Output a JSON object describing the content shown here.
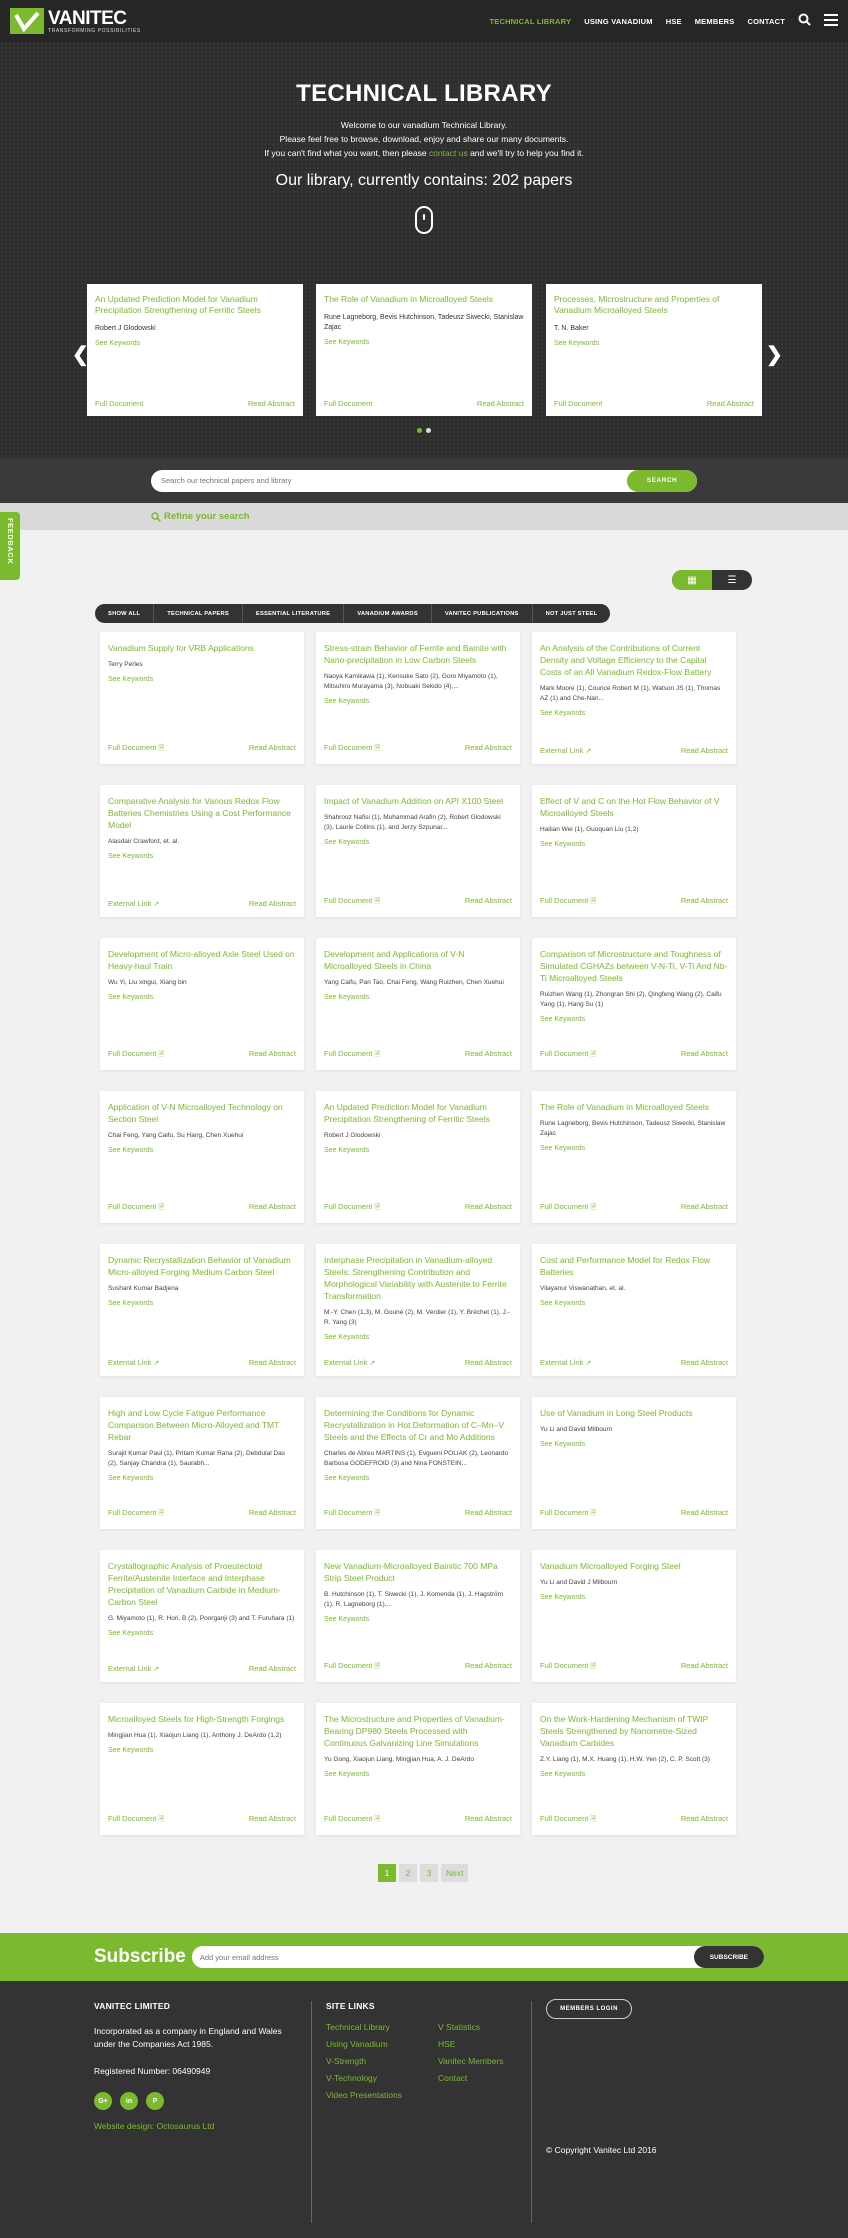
{
  "header": {
    "logo_name": "VANITEC",
    "logo_tagline": "TRANSFORMING POSSIBILITIES",
    "nav": [
      "TECHNICAL LIBRARY",
      "USING VANADIUM",
      "HSE",
      "MEMBERS",
      "CONTACT"
    ],
    "icons": [
      "search-icon",
      "menu-icon"
    ]
  },
  "hero": {
    "title": "TECHNICAL LIBRARY",
    "intro_line1": "Welcome to our vanadium Technical Library.",
    "intro_line2": "Please feel free to browse, download, enjoy and share our many documents.",
    "intro_line3_pre": "If you can't find what you want, then please ",
    "intro_line3_link": "contact us",
    "intro_line3_post": " and we'll try to help you find it.",
    "count": "Our library, currently contains: 202 papers"
  },
  "carousel": {
    "cards": [
      {
        "title": "An Updated Prediction Model for Vanadium Precipitation Strengthening of Ferritic Steels",
        "authors": "Robert J Glodowski",
        "keywords": "See Keywords",
        "doc": "Full Document",
        "abstract": "Read Abstract"
      },
      {
        "title": "The Role of Vanadium in Microalloyed Steels",
        "authors": "Rune Lagneborg, Bevis Hutchinson, Tadeusz Siwecki, Stanislaw Zajac",
        "keywords": "See Keywords",
        "doc": "Full Document",
        "abstract": "Read Abstract"
      },
      {
        "title": "Processes, Microstructure and Properties of Vanadium Microalloyed Steels",
        "authors": "T. N. Baker",
        "keywords": "See Keywords",
        "doc": "Full Document",
        "abstract": "Read Abstract"
      }
    ],
    "active_slide": 1,
    "slide_count": 2
  },
  "search": {
    "placeholder": "Search our technical papers and library",
    "button": "SEARCH",
    "refine": "Refine your search"
  },
  "feedback": "FEEDBACK",
  "filters": [
    "SHOW ALL",
    "TECHNICAL PAPERS",
    "ESSENTIAL LITERATURE",
    "VANADIUM AWARDS",
    "VANITEC PUBLICATIONS",
    "NOT JUST STEEL"
  ],
  "papers": [
    {
      "title": "Vanadium Supply for VRB Applications",
      "authors": "Terry Perles",
      "keywords": "See Keywords",
      "doc": "Full Document",
      "abstract": "Read Abstract"
    },
    {
      "title": "Stress-strain Behavior of Ferrite and Bainite with Nano-precipitation in Low Carbon Steels",
      "authors": "Naoya Kamikawa (1), Kensuke Sato (2), Goro Miyamoto (1), Mitsuhiro Murayama (3), Nobuaki Sekido (4),...",
      "keywords": "See Keywords",
      "doc": "Full Document",
      "abstract": "Read Abstract"
    },
    {
      "title": "An Analysis of the Contributions of Current Density and Voltage Efficiency to the Capital Costs of an All Vanadium Redox-Flow Battery",
      "authors": "Mark Moore (1), Counce Robert M (1), Watson JS (1), Thomas AZ (1) and Che-Nan...",
      "keywords": "See Keywords",
      "doc": "External Link",
      "abstract": "Read Abstract"
    },
    {
      "title": "Comparative Analysis for Various Redox Flow Batteries Chemistries Using a Cost Performance Model",
      "authors": "Alasdair Crawford, et. al.",
      "keywords": "See Keywords",
      "doc": "External Link",
      "abstract": "Read Abstract"
    },
    {
      "title": "Impact of Vanadium Addition on API X100 Steel",
      "authors": "Shahrooz Nafisi (1), Muhammad Arafin (2), Robert Glodowski (3), Laurie Collins (1), and Jerzy Szpunar...",
      "keywords": "See Keywords",
      "doc": "Full Document",
      "abstract": "Read Abstract"
    },
    {
      "title": "Effect of V and C on the Hot Flow Behavior of V Microalloyed Steels",
      "authors": "Hailian Wei (1), Guoquan Liu (1,2)",
      "keywords": "See Keywords",
      "doc": "Full Document",
      "abstract": "Read Abstract"
    },
    {
      "title": "Development of Micro-alloyed Axle Steel Used on Heavy-haul Train",
      "authors": "Wu Yi, Liu xingui, Xiang bin",
      "keywords": "See Keywords",
      "doc": "Full Document",
      "abstract": "Read Abstract"
    },
    {
      "title": "Development and Applications of V-N Microalloyed Steels in China",
      "authors": "Yang Caifu, Pan Tao, Chai Feng, Wang Ruizhen, Chen Xuehui",
      "keywords": "See Keywords",
      "doc": "Full Document",
      "abstract": "Read Abstract"
    },
    {
      "title": "Comparison of Microstructure and Toughness of Simulated CGHAZs between V-N-Ti, V-Ti And Nb-Ti Microalloyed Steels",
      "authors": "Ruizhen Wang (1), Zhongran Shi (2), Qingfeng Wang (2), Caifu Yang (1), Hang Su (1)",
      "keywords": "See Keywords",
      "doc": "Full Document",
      "abstract": "Read Abstract"
    },
    {
      "title": "Application of V-N Microalloyed Technology on Section Steel",
      "authors": "Chai Feng, Yang Caifu, Su Hang, Chen Xuehui",
      "keywords": "See Keywords",
      "doc": "Full Document",
      "abstract": "Read Abstract"
    },
    {
      "title": "An Updated Prediction Model for Vanadium Precipitation Strengthening of Ferritic Steels",
      "authors": "Robert J Glodowski",
      "keywords": "See Keywords",
      "doc": "Full Document",
      "abstract": "Read Abstract"
    },
    {
      "title": "The Role of Vanadium in Microalloyed Steels",
      "authors": "Rune Lagneborg, Bevis Hutchinson, Tadeusz Siwecki, Stanislaw Zajac",
      "keywords": "See Keywords",
      "doc": "Full Document",
      "abstract": "Read Abstract"
    },
    {
      "title": "Dynamic Recrystallization Behavior of Vanadium Micro-alloyed Forging Medium Carbon Steel",
      "authors": "Sushant Kumar Badjena",
      "keywords": "See Keywords",
      "doc": "External Link",
      "abstract": "Read Abstract"
    },
    {
      "title": "Interphase Precipitation in Vanadium-alloyed Steels: Strengthening Contribution and Morphological Variability with Austenite to Ferrite Transformation",
      "authors": "M.-Y. Chen (1,3), M. Gouné (2), M. Verdier (1), Y. Bréchet (1), J.-R. Yang (3)",
      "keywords": "See Keywords",
      "doc": "External Link",
      "abstract": "Read Abstract"
    },
    {
      "title": "Cost and Performance Model for Redox Flow Batteries",
      "authors": "Vilayanur Viswanathan, et. al.",
      "keywords": "See Keywords",
      "doc": "External Link",
      "abstract": "Read Abstract"
    },
    {
      "title": "High and Low Cycle Fatigue Performance Comparison Between Micro-Alloyed and TMT Rebar",
      "authors": "Surajit Kumar Paul (1), Pritam Kumar Rana (2), Debdulal Das (2), Sanjay Chandra (1), Saurabh...",
      "keywords": "See Keywords",
      "doc": "Full Document",
      "abstract": "Read Abstract"
    },
    {
      "title": "Determining the Conditions for Dynamic Recrystallization in Hot Deformation of C–Mn–V Steels and the Effects of Cr and Mo Additions",
      "authors": "Charles de Abreu MARTINS (1), Evgueni POLIAK (2), Leonardo Barbosa GODEFROID (3) and Nina FONSTEIN...",
      "keywords": "See Keywords",
      "doc": "Full Document",
      "abstract": "Read Abstract"
    },
    {
      "title": "Use of Vanadium in Long Steel Products",
      "authors": "Yu Li and David Milbourn",
      "keywords": "See Keywords",
      "doc": "Full Document",
      "abstract": "Read Abstract"
    },
    {
      "title": "Crystallographic Analysis of Proeutectoid Ferrite/Austenite Interface and Interphase Precipitation of Vanadium Carbide in Medium-Carbon Steel",
      "authors": "G. Miyamoto (1), R. Hori, B (2), Poorganji (3) and T. Furuhara (1)",
      "keywords": "See Keywords",
      "doc": "External Link",
      "abstract": "Read Abstract"
    },
    {
      "title": "New Vanadium-Microalloyed Bainitic 700 MPa Strip Steel Product",
      "authors": "B. Hutchinson (1), T. Siwecki (1), J. Komenda (1), J. Hagström (1), R. Lagneborg (1),...",
      "keywords": "See Keywords",
      "doc": "Full Document",
      "abstract": "Read Abstract"
    },
    {
      "title": "Vanadium Microalloyed Forging Steel",
      "authors": "Yu Li and David J Milbourn",
      "keywords": "See Keywords",
      "doc": "Full Document",
      "abstract": "Read Abstract"
    },
    {
      "title": "Microalloyed Steels for High-Strength Forgings",
      "authors": "Mingjian Hua (1), Xiaojun Liang (1), Anthony J. DeArdo (1,2)",
      "keywords": "See Keywords",
      "doc": "Full Document",
      "abstract": "Read Abstract"
    },
    {
      "title": "The Microstructure and Properties of Vanadium-Bearing DP980 Steels Processed with Continuous Galvanizing Line Simulations",
      "authors": "Yu Gong, Xiaojun Liang, Mingjian Hua, A. J. DeArdo",
      "keywords": "See Keywords",
      "doc": "Full Document",
      "abstract": "Read Abstract"
    },
    {
      "title": "On the Work-Hardening Mechanism of TWIP Steels Strengthened by Nanometre-Sized Vanadium Carbides",
      "authors": "Z.Y. Liang (1), M.X. Huang (1), H.W. Yen (2), C. P. Scott (3)",
      "keywords": "See Keywords",
      "doc": "Full Document",
      "abstract": "Read Abstract"
    }
  ],
  "pagination": {
    "pages": [
      "1",
      "2",
      "3"
    ],
    "next": "Next",
    "current": "1"
  },
  "subscribe": {
    "title": "Subscribe",
    "placeholder": "Add your email address",
    "button": "SUBSCRIBE"
  },
  "footer": {
    "company_title": "VANITEC LIMITED",
    "company_text": "Incorporated as a company in England and Wales under the Companies Act 1985.",
    "registered": "Registered Number: 06490949",
    "social": [
      "G+",
      "in",
      "P"
    ],
    "design_credit": "Website design: Octosaurus Ltd",
    "sitelinks_title": "SITE LINKS",
    "links_col1": [
      "Technical Library",
      "Using Vanadium",
      "V-Strength",
      "V-Technology",
      "Video Presentations"
    ],
    "links_col2": [
      "V Statistics",
      "HSE",
      "Vanitec Members",
      "Contact"
    ],
    "members_login": "MEMBERS LOGIN",
    "copyright": "© Copyright Vanitec Ltd 2016"
  },
  "colors": {
    "accent": "#7bb92f",
    "dark": "#333333",
    "hero": "#2e2e2e"
  }
}
